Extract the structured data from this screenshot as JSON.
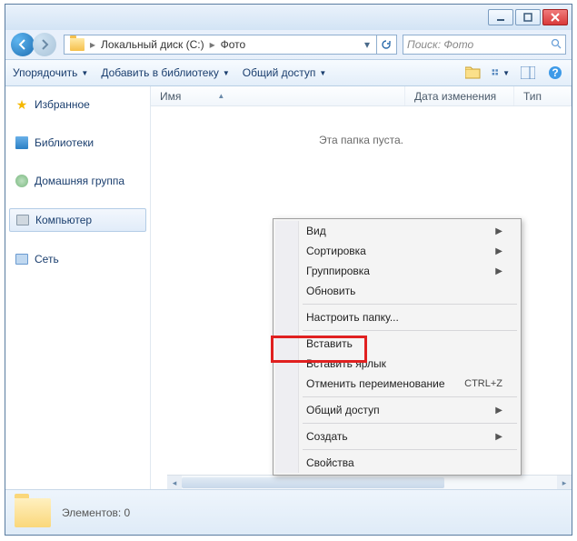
{
  "breadcrumb": {
    "drive": "Локальный диск (C:)",
    "folder": "Фото"
  },
  "search": {
    "placeholder": "Поиск: Фото"
  },
  "toolbar": {
    "organize": "Упорядочить",
    "addlib": "Добавить в библиотеку",
    "share": "Общий доступ"
  },
  "columns": {
    "name": "Имя",
    "modified": "Дата изменения",
    "type": "Тип"
  },
  "empty": "Эта папка пуста.",
  "sidebar": {
    "favorites": "Избранное",
    "libraries": "Библиотеки",
    "homegroup": "Домашняя группа",
    "computer": "Компьютер",
    "network": "Сеть"
  },
  "status": "Элементов: 0",
  "context": {
    "view": "Вид",
    "sort": "Сортировка",
    "group": "Группировка",
    "refresh": "Обновить",
    "customize": "Настроить папку...",
    "paste": "Вставить",
    "pasteshortcut": "Вставить ярлык",
    "undo": "Отменить переименование",
    "undokey": "CTRL+Z",
    "share": "Общий доступ",
    "new": "Создать",
    "properties": "Свойства"
  }
}
